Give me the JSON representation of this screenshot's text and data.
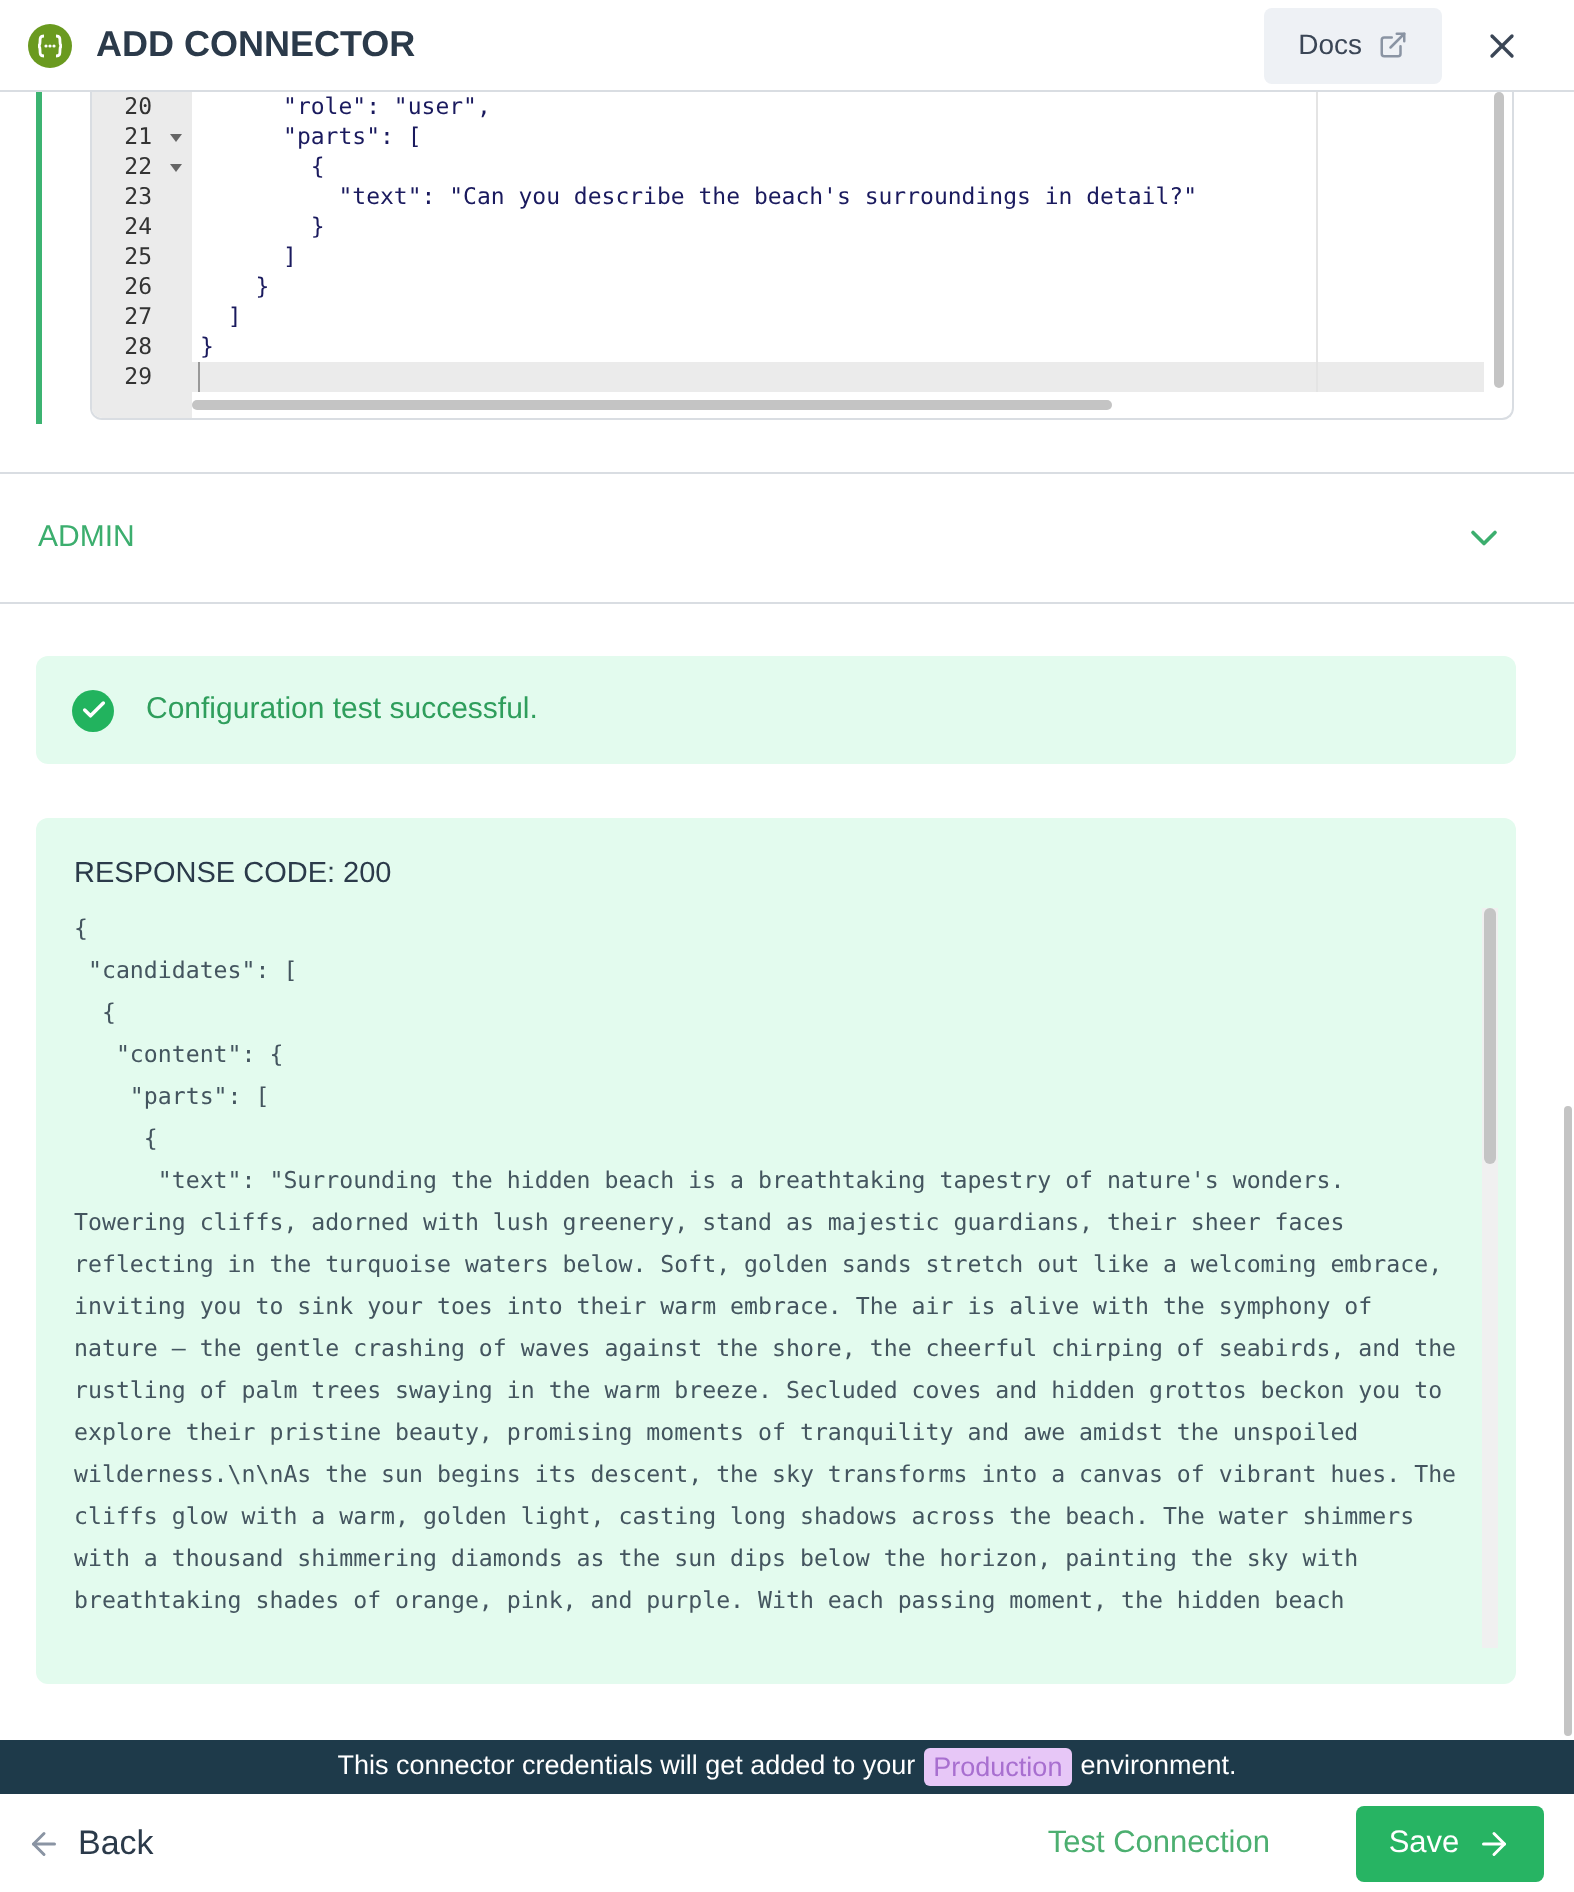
{
  "header": {
    "title": "ADD CONNECTOR",
    "docs_button": "Docs"
  },
  "editor": {
    "lines": [
      {
        "number": "20",
        "foldable": false,
        "code": "      \"role\": \"user\","
      },
      {
        "number": "21",
        "foldable": true,
        "code": "      \"parts\": ["
      },
      {
        "number": "22",
        "foldable": true,
        "code": "        {"
      },
      {
        "number": "23",
        "foldable": false,
        "code": "          \"text\": \"Can you describe the beach's surroundings in detail?\""
      },
      {
        "number": "24",
        "foldable": false,
        "code": "        }"
      },
      {
        "number": "25",
        "foldable": false,
        "code": "      ]"
      },
      {
        "number": "26",
        "foldable": false,
        "code": "    }"
      },
      {
        "number": "27",
        "foldable": false,
        "code": "  ]"
      },
      {
        "number": "28",
        "foldable": false,
        "code": "}"
      },
      {
        "number": "29",
        "foldable": false
      }
    ]
  },
  "admin_section": {
    "label": "ADMIN",
    "expanded": false
  },
  "success_message": "Configuration test successful.",
  "response": {
    "title": "RESPONSE CODE: 200",
    "body_lines": [
      "{",
      " \"candidates\": [",
      "  {",
      "   \"content\": {",
      "    \"parts\": [",
      "     {",
      "      \"text\": \"Surrounding the hidden beach is a breathtaking tapestry of nature's wonders.",
      "Towering cliffs, adorned with lush greenery, stand as majestic guardians, their sheer faces",
      "reflecting in the turquoise waters below. Soft, golden sands stretch out like a welcoming embrace,",
      "inviting you to sink your toes into their warm embrace. The air is alive with the symphony of",
      "nature – the gentle crashing of waves against the shore, the cheerful chirping of seabirds, and the",
      "rustling of palm trees swaying in the warm breeze. Secluded coves and hidden grottos beckon you to",
      "explore their pristine beauty, promising moments of tranquility and awe amidst the unspoiled",
      "wilderness.\\n\\nAs the sun begins its descent, the sky transforms into a canvas of vibrant hues. The",
      "cliffs glow with a warm, golden light, casting long shadows across the beach. The water shimmers",
      "with a thousand shimmering diamonds as the sun dips below the horizon, painting the sky with",
      "breathtaking shades of orange, pink, and purple. With each passing moment, the hidden beach"
    ]
  },
  "notice": {
    "before": "This connector credentials will get added to your",
    "environment": "Production",
    "after": "environment."
  },
  "footer": {
    "back": "Back",
    "test": "Test Connection",
    "save": "Save"
  }
}
